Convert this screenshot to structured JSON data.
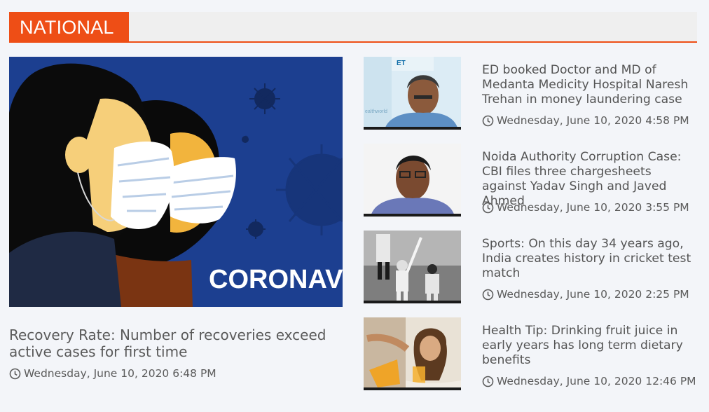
{
  "section": {
    "title": "NATIONAL"
  },
  "feature": {
    "image_text": "CORONAV",
    "title": "Recovery Rate: Number of recoveries exceed active cases for first time",
    "time": "Wednesday, June 10, 2020 6:48 PM"
  },
  "stories": [
    {
      "title": "ED booked Doctor and MD of Medanta Medicity Hospital Naresh Trehan in money laundering case",
      "time": "Wednesday, June 10, 2020 4:58 PM",
      "thumb_text": "ET",
      "thumb_text2": "ealthworld"
    },
    {
      "title": "Noida Authority Corruption Case: CBI files three chargesheets against Yadav Singh and Javed Ahmed",
      "time": "Wednesday, June 10, 2020 3:55 PM"
    },
    {
      "title": "Sports: On this day 34 years ago, India creates history in cricket test match",
      "time": "Wednesday, June 10, 2020 2:25 PM"
    },
    {
      "title": "Health Tip: Drinking fruit juice in early years has long term dietary benefits",
      "time": "Wednesday, June 10, 2020 12:46 PM"
    }
  ],
  "icons": {
    "time": "clock-icon"
  },
  "colors": {
    "accent": "#ee4e16",
    "background": "#f3f5f9",
    "header_bar": "#efefef"
  }
}
